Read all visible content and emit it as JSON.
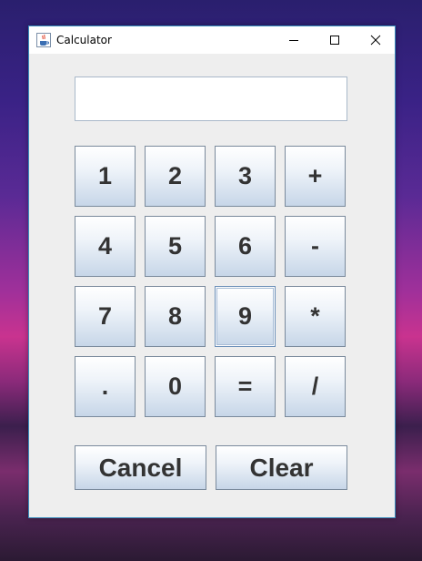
{
  "window": {
    "title": "Calculator",
    "app_icon": "java-cup-icon"
  },
  "title_controls": {
    "minimize_icon": "minimize-icon",
    "maximize_icon": "maximize-icon",
    "close_icon": "close-icon"
  },
  "display": {
    "value": "",
    "placeholder": ""
  },
  "keypad": {
    "rows": [
      [
        "1",
        "2",
        "3",
        "+"
      ],
      [
        "4",
        "5",
        "6",
        "-"
      ],
      [
        "7",
        "8",
        "9",
        "*"
      ],
      [
        ".",
        "0",
        "=",
        "/"
      ]
    ],
    "focused_key": "9"
  },
  "actions": {
    "cancel_label": "Cancel",
    "clear_label": "Clear"
  },
  "colors": {
    "window_border": "#3a8fbf",
    "client_bg": "#eeeeee",
    "key_text": "#333333",
    "key_gradient_bottom": "#c7d6e8"
  }
}
